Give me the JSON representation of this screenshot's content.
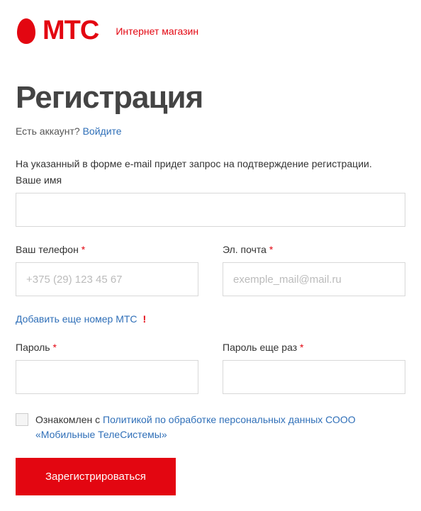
{
  "brand": {
    "name": "МТС",
    "tagline": "Интернет магазин"
  },
  "title": "Регистрация",
  "login_prompt_text": "Есть аккаунт? ",
  "login_link": "Войдите",
  "info": "На указанный в форме e-mail придет запрос на подтверждение регистрации.",
  "fields": {
    "name": {
      "label": "Ваше имя"
    },
    "phone": {
      "label": "Ваш телефон ",
      "placeholder": "+375 (29) 123 45 67"
    },
    "email": {
      "label": "Эл. почта ",
      "placeholder": "exemple_mail@mail.ru"
    },
    "password": {
      "label": "Пароль "
    },
    "password_confirm": {
      "label": "Пароль еще раз "
    }
  },
  "add_phone_label": "Добавить еще номер МТС",
  "consent": {
    "prefix": "Ознакомлен с ",
    "link": "Политикой по обработке персональных данных СООО «Мобильные ТелеСистемы»"
  },
  "submit_label": "Зарегистрироваться",
  "required_marker": "*",
  "warn_marker": "!"
}
